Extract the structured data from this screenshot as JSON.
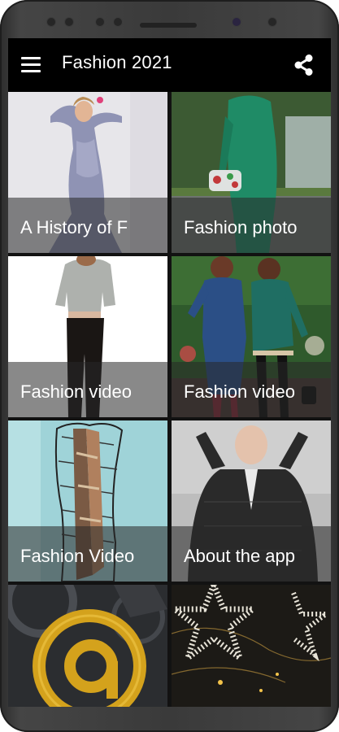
{
  "app": {
    "title": "Fashion 2021"
  },
  "icons": {
    "menu": "hamburger-menu-icon",
    "share": "share-icon"
  },
  "tiles": [
    {
      "caption": "A History of F"
    },
    {
      "caption": "Fashion photo"
    },
    {
      "caption": "Fashion video"
    },
    {
      "caption": "Fashion video"
    },
    {
      "caption": "Fashion Video"
    },
    {
      "caption": "About the app"
    },
    {
      "caption": ""
    },
    {
      "caption": ""
    }
  ],
  "colors": {
    "appbar": "#000000",
    "caption_band": "rgba(40,40,40,0.55)"
  }
}
